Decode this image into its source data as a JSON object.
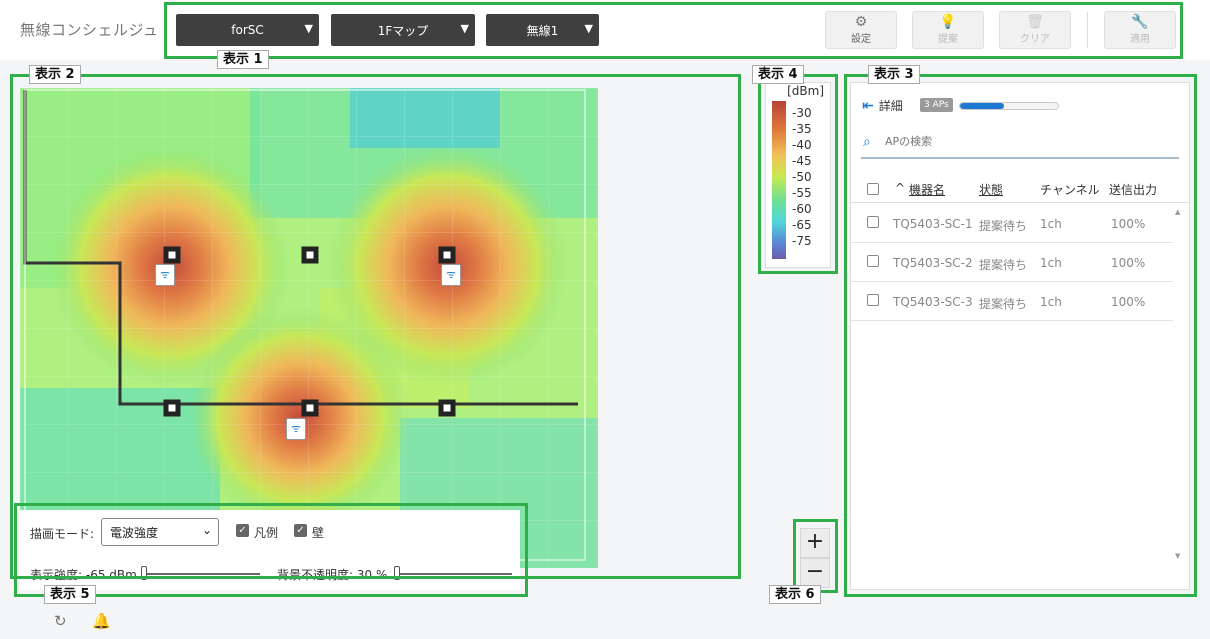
{
  "app": {
    "title": "無線コンシェルジュ"
  },
  "toolbar": {
    "site_select": "forSC",
    "map_select": "1Fマップ",
    "radio_select": "無線1",
    "settings_label": "設定",
    "suggest_label": "提案",
    "clear_label": "クリア",
    "apply_label": "適用"
  },
  "annotations": [
    "表示 1",
    "表示 2",
    "表示 3",
    "表示 4",
    "表示 5",
    "表示 6"
  ],
  "legend": {
    "unit": "[dBm]",
    "labels": [
      "-30",
      "-35",
      "-40",
      "-45",
      "-50",
      "-55",
      "-60",
      "-65",
      "-75"
    ]
  },
  "ap_panel": {
    "detail_label": "詳細",
    "ap_count_badge": "3 APs",
    "progress_fraction": 0.45,
    "search_placeholder": "APの検索",
    "columns": {
      "sort_indicator": "^",
      "name": "機器名",
      "status": "状態",
      "channel": "チャンネル",
      "power": "送信出力"
    },
    "rows": [
      {
        "name": "TQ5403-SC-1",
        "status": "提案待ち",
        "channel": "1ch",
        "power": "100%"
      },
      {
        "name": "TQ5403-SC-2",
        "status": "提案待ち",
        "channel": "1ch",
        "power": "100%"
      },
      {
        "name": "TQ5403-SC-3",
        "status": "提案待ち",
        "channel": "1ch",
        "power": "100%"
      }
    ]
  },
  "controls": {
    "mode_label": "描画モード:",
    "mode_value": "電波強度",
    "legend_checkbox": "凡例",
    "wall_checkbox": "壁",
    "strength_label": "表示強度: -65 dBm",
    "opacity_label": "背景不透明度: 30 %"
  },
  "zoom": {
    "in": "+",
    "out": "−"
  },
  "colors": {
    "accent": "#1e78d2",
    "annotation_box": "#2fae4a",
    "dropdown_bg": "#3f3f3f"
  },
  "icons": {
    "settings": "gear-icon",
    "suggest": "lightbulb-icon",
    "clear": "trash-icon",
    "apply": "wrench-icon",
    "refresh": "refresh-icon",
    "notify": "bell-icon"
  }
}
